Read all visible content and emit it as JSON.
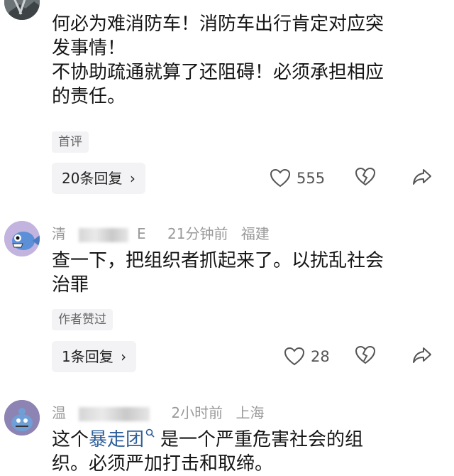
{
  "comments": [
    {
      "lines": [
        "何必为难消防车！消防车出行肯定对应突",
        "发事情！",
        "不协助疏通就算了还阻碍！必须承担相应",
        "的责任。"
      ],
      "tag": "首评",
      "reply_label": "20条回复",
      "likes": "555"
    },
    {
      "user_start": "清",
      "user_end": "E",
      "time": "21分钟前",
      "location": "福建",
      "lines": [
        "查一下，把组织者抓起来了。以扰乱社会",
        "治罪"
      ],
      "tag": "作者赞过",
      "reply_label": "1条回复",
      "likes": "28"
    },
    {
      "user_start": "温",
      "time": "2小时前",
      "location": "上海",
      "line1_a": "这个",
      "line1_link": "暴走团",
      "line1_b": "是一个严重危害社会的组",
      "line2": "织。必须严加打击和取缔。"
    }
  ],
  "colors": {
    "link": "#2f5f9a",
    "meta": "#9a9a9a",
    "tag_bg": "#f3f3f5"
  },
  "icons": [
    "heart-outline-icon",
    "broken-heart-icon",
    "share-arrow-icon",
    "search-icon",
    "chevron-right-icon"
  ]
}
